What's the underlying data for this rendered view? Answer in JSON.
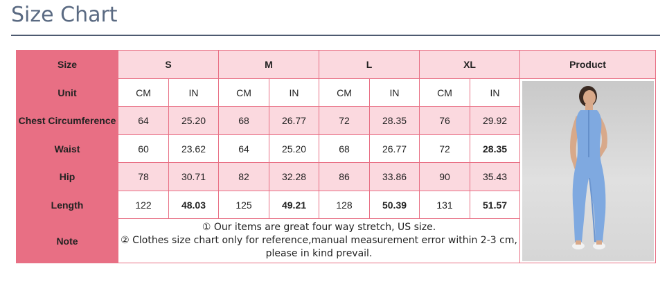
{
  "page": {
    "title": "Size Chart"
  },
  "table": {
    "size_label": "Size",
    "sizes": [
      "S",
      "M",
      "L",
      "XL"
    ],
    "product_label": "Product",
    "unit_label": "Unit",
    "units": [
      "CM",
      "IN",
      "CM",
      "IN",
      "CM",
      "IN",
      "CM",
      "IN"
    ],
    "rows": [
      {
        "label": "Chest Circumference",
        "values": [
          "64",
          "25.20",
          "68",
          "26.77",
          "72",
          "28.35",
          "76",
          "29.92"
        ]
      },
      {
        "label": "Waist",
        "values": [
          "60",
          "23.62",
          "64",
          "25.20",
          "68",
          "26.77",
          "72",
          "28.35"
        ]
      },
      {
        "label": "Hip",
        "values": [
          "78",
          "30.71",
          "82",
          "32.28",
          "86",
          "33.86",
          "90",
          "35.43"
        ]
      },
      {
        "label": "Length",
        "values": [
          "122",
          "48.03",
          "125",
          "49.21",
          "128",
          "50.39",
          "131",
          "51.57"
        ]
      }
    ],
    "note_label": "Note",
    "note_lines": [
      "① Our items are great four way stretch, US size.",
      "② Clothes size chart only for reference,manual measurement error within 2-3 cm, please in kind prevail."
    ],
    "product_image": "blue-sleeveless-zip-jumpsuit-photo"
  }
}
